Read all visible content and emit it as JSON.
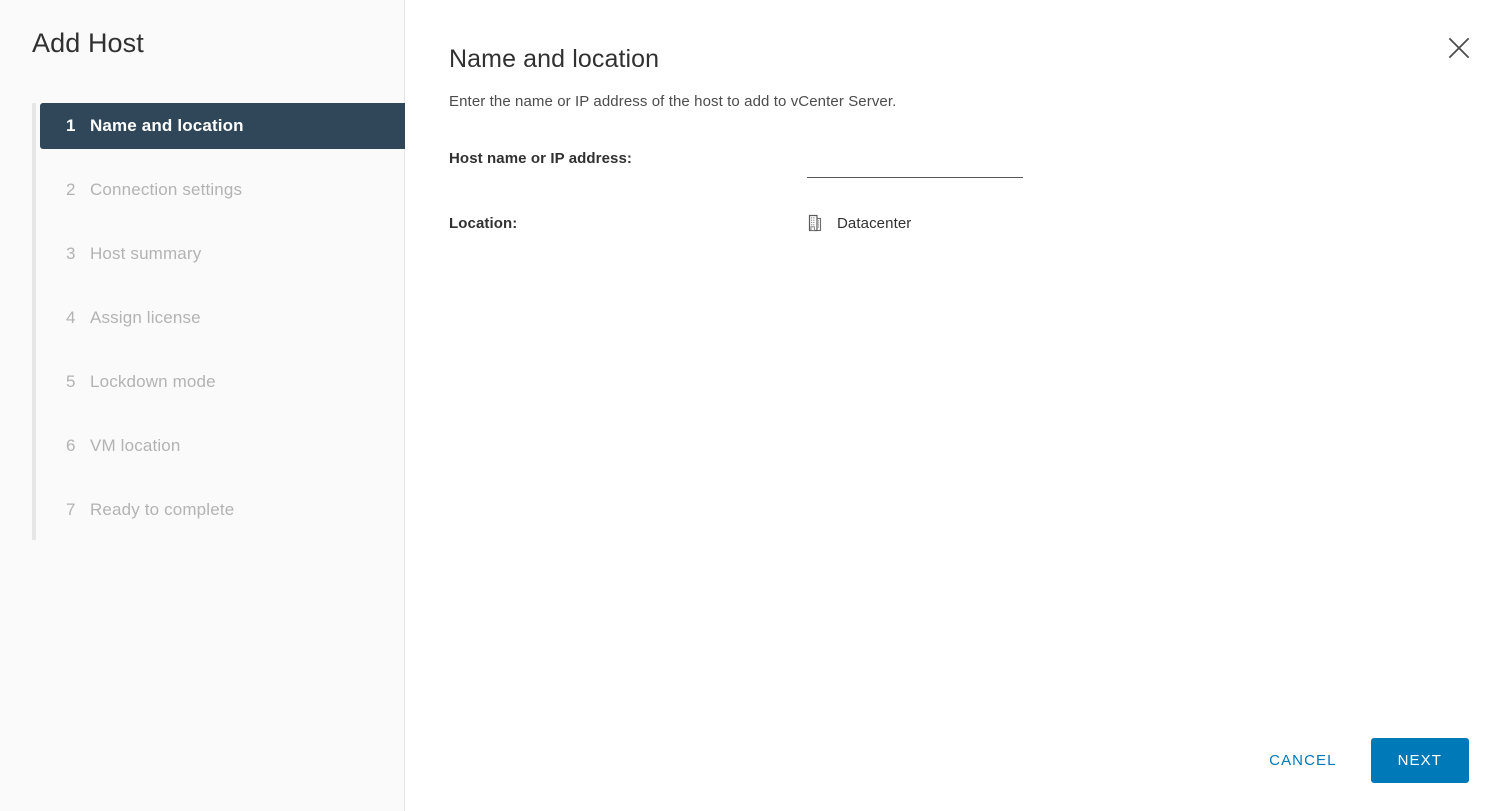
{
  "wizard": {
    "title": "Add Host",
    "steps": [
      {
        "num": "1",
        "label": "Name and location",
        "active": true
      },
      {
        "num": "2",
        "label": "Connection settings",
        "active": false
      },
      {
        "num": "3",
        "label": "Host summary",
        "active": false
      },
      {
        "num": "4",
        "label": "Assign license",
        "active": false
      },
      {
        "num": "5",
        "label": "Lockdown mode",
        "active": false
      },
      {
        "num": "6",
        "label": "VM location",
        "active": false
      },
      {
        "num": "7",
        "label": "Ready to complete",
        "active": false
      }
    ]
  },
  "page": {
    "title": "Name and location",
    "description": "Enter the name or IP address of the host to add to vCenter Server.",
    "close_icon": "close-icon"
  },
  "form": {
    "host_label": "Host name or IP address:",
    "host_value": "",
    "host_placeholder": "",
    "location_label": "Location:",
    "location_icon": "datacenter-building-icon",
    "location_value": "Datacenter"
  },
  "footer": {
    "cancel_label": "CANCEL",
    "next_label": "NEXT"
  },
  "colors": {
    "accent": "#0079b8",
    "active_step_bg": "#2f4758",
    "sidebar_bg": "#fafafa",
    "text": "#313131",
    "muted_text": "#b3b3b3",
    "divider": "#e3e5e8"
  }
}
